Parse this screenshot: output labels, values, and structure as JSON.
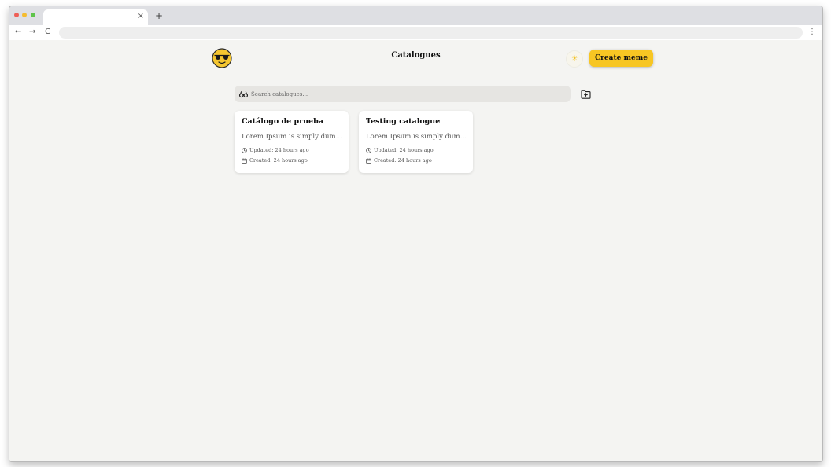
{
  "browser": {
    "tab_close": "×",
    "new_tab": "+",
    "back": "←",
    "forward": "→",
    "reload": "C",
    "menu": "⋮"
  },
  "header": {
    "logo_icon": "sunglasses-emoji-icon",
    "title": "Catalogues",
    "theme_toggle_icon": "sun-icon",
    "create_button_label": "Create meme"
  },
  "search": {
    "placeholder": "Search catalogues...",
    "value": "",
    "icon": "binoculars-icon"
  },
  "add_catalogue_icon": "folder-plus-icon",
  "catalogues": [
    {
      "title": "Catálogo de prueba",
      "description": "Lorem Ipsum is simply dummy text of the printing and typesetting industry.",
      "updated": "Updated: 24 hours ago",
      "created": "Created: 24 hours ago"
    },
    {
      "title": "Testing catalogue",
      "description": "Lorem Ipsum is simply dummy text of the printing and typesetting industry.",
      "updated": "Updated: 24 hours ago",
      "created": "Created: 24 hours ago"
    }
  ],
  "colors": {
    "accent": "#f7c623",
    "background": "#f4f4f2",
    "card": "#ffffff",
    "search_bg": "#e6e5e2"
  }
}
